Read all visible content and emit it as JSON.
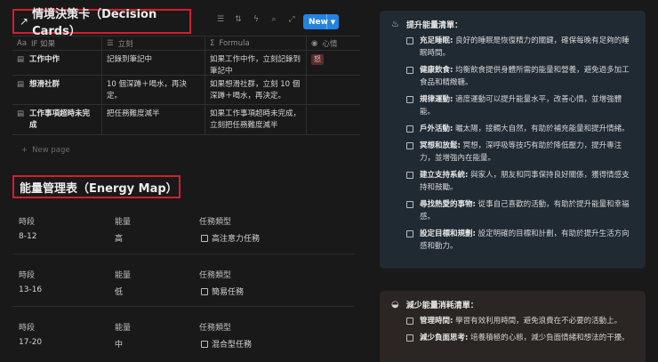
{
  "decision": {
    "title_arrow": "↗",
    "title": "情境決策卡（Decision Cards）",
    "new_label": "New",
    "columns": [
      {
        "icon": "Aa",
        "label": "IF 如果"
      },
      {
        "icon": "☰",
        "label": "立刻"
      },
      {
        "icon": "Σ",
        "label": "Formula"
      },
      {
        "icon": "◉",
        "label": "心情"
      }
    ],
    "rows": [
      {
        "if": "工作中作",
        "now": "記錄到筆記中",
        "formula": "如果工作中作，立刻記錄到筆記中",
        "mood": "怒"
      },
      {
        "if": "想滑社群",
        "now": "10 個深蹲＋喝水，再決定。",
        "formula": "如果想滑社群，立刻 10 個深蹲＋喝水，再決定。",
        "mood": ""
      },
      {
        "if": "工作事項超時未完成",
        "now": "把任務難度減半",
        "formula": "如果工作事項超時未完成，立刻把任務難度減半",
        "mood": ""
      }
    ],
    "new_page": "New page"
  },
  "energy": {
    "title": "能量管理表（Energy Map）",
    "labels": {
      "period": "時段",
      "level": "能量",
      "task": "任務類型"
    },
    "rows": [
      {
        "period": "8-12",
        "level": "高",
        "task": "高注意力任務"
      },
      {
        "period": "13-16",
        "level": "低",
        "task": "簡易任務"
      },
      {
        "period": "17-20",
        "level": "中",
        "task": "混合型任務"
      }
    ]
  },
  "boost": {
    "icon": "lamp-icon",
    "title": "提升能量清單：",
    "items": [
      {
        "bold": "充足睡眠:",
        "text": " 良好的睡眠是恢復精力的關鍵，確保每晚有足夠的睡眠時間。"
      },
      {
        "bold": "健康飲食:",
        "text": " 均衡飲食提供身體所需的能量和營養，避免過多加工食品和精緻糖。"
      },
      {
        "bold": "規律運動:",
        "text": " 適度運動可以提升能量水平，改善心情，並增強體能。"
      },
      {
        "bold": "戶外活動:",
        "text": " 曬太陽，接觸大自然，有助於補充能量和提升情緒。"
      },
      {
        "bold": "冥想和放鬆:",
        "text": " 冥想，深呼吸等技巧有助於降低壓力，提升專注力，並增強內在能量。"
      },
      {
        "bold": "建立支持系統:",
        "text": " 與家人，朋友和同事保持良好關係，獲得情感支持和鼓勵。"
      },
      {
        "bold": "尋找熱愛的事物:",
        "text": " 從事自己喜歡的活動，有助於提升能量和幸福感。"
      },
      {
        "bold": "設定目標和規劃:",
        "text": " 設定明確的目標和計劃，有助於提升生活方向感和動力。"
      }
    ]
  },
  "reduce": {
    "icon": "bowl-icon",
    "title": "減少能量消耗清單：",
    "items": [
      {
        "bold": "管理時間:",
        "text": " 學習有效利用時間，避免浪費在不必要的活動上。"
      },
      {
        "bold": "減少負面思考:",
        "text": " 培養積極的心態，減少負面情緒和想法的干擾。"
      }
    ]
  }
}
